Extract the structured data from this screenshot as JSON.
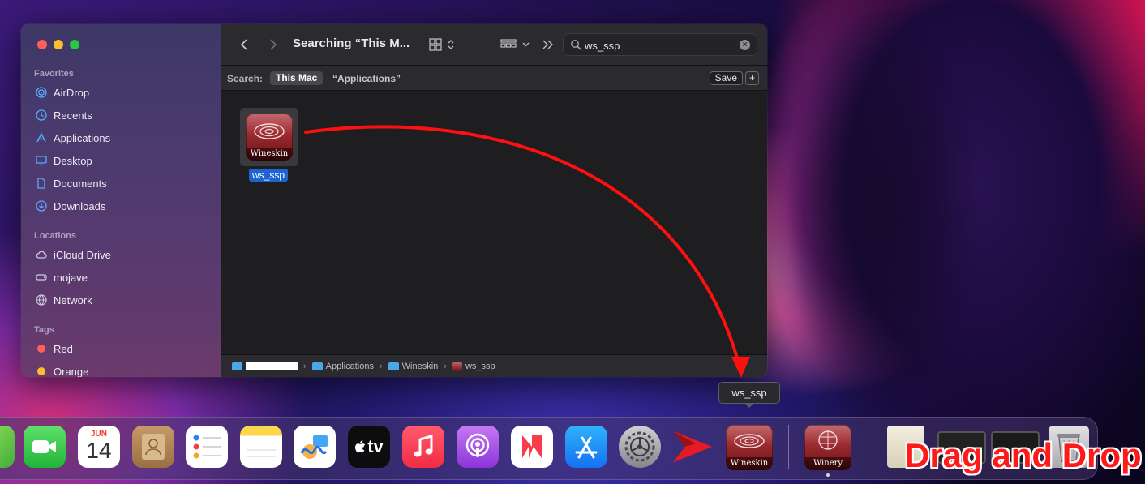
{
  "finder": {
    "title": "Searching “This M...",
    "search_value": "ws_ssp",
    "scope": {
      "label": "Search:",
      "this_mac": "This Mac",
      "applications": "“Applications”",
      "save": "Save",
      "plus": "+"
    },
    "sidebar": {
      "favorites_header": "Favorites",
      "favorites": [
        {
          "label": "AirDrop",
          "icon": "airdrop-icon"
        },
        {
          "label": "Recents",
          "icon": "clock-icon"
        },
        {
          "label": "Applications",
          "icon": "applications-icon"
        },
        {
          "label": "Desktop",
          "icon": "desktop-icon"
        },
        {
          "label": "Documents",
          "icon": "document-icon"
        },
        {
          "label": "Downloads",
          "icon": "download-icon"
        }
      ],
      "locations_header": "Locations",
      "locations": [
        {
          "label": "iCloud Drive",
          "icon": "cloud-icon"
        },
        {
          "label": "mojave",
          "icon": "disk-icon"
        },
        {
          "label": "Network",
          "icon": "globe-icon"
        }
      ],
      "tags_header": "Tags",
      "tags": [
        {
          "label": "Red",
          "color": "#ff5f57"
        },
        {
          "label": "Orange",
          "color": "#febc2e"
        }
      ]
    },
    "result": {
      "label": "ws_ssp",
      "icon_text": "Wineskin"
    },
    "pathbar": [
      "Applications",
      "Wineskin",
      "ws_ssp"
    ]
  },
  "tooltip": "ws_ssp",
  "dock": {
    "calendar_month": "JUN",
    "calendar_day": "14",
    "tv_label": "tv",
    "wineskin_label": "Wineskin",
    "winery_label": "Winery"
  },
  "annotation": "Drag and Drop",
  "colors": {
    "arrow": "#ff1010",
    "selection": "#1f63d1"
  }
}
